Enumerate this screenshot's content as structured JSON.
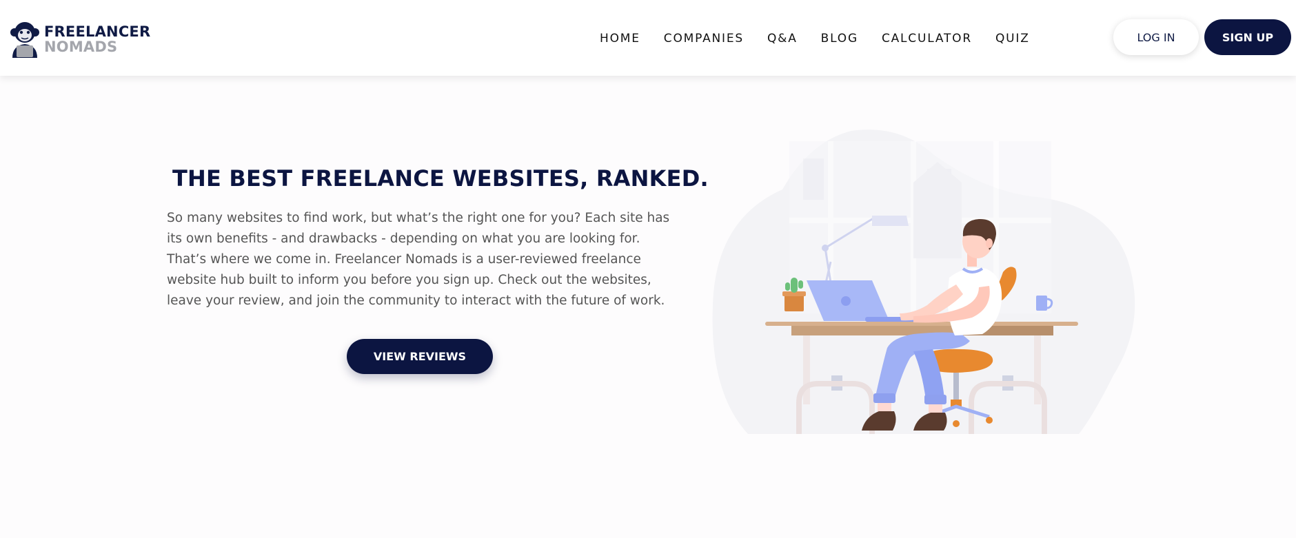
{
  "brand": {
    "name_top": "FREELANCER",
    "name_bottom": "NOMADS"
  },
  "nav": {
    "items": [
      "HOME",
      "COMPANIES",
      "Q&A",
      "BLOG",
      "CALCULATOR",
      "QUIZ"
    ]
  },
  "auth": {
    "login_label": "LOG IN",
    "signup_label": "SIGN UP"
  },
  "hero": {
    "title": "THE BEST FREELANCE WEBSITES, RANKED.",
    "body": "So many websites to find work, but what’s the right one for you? Each site has its own benefits - and drawbacks - depending on what you are looking for. That’s where we come in. Freelancer Nomads is a user-reviewed freelance website hub built to inform you before you sign up. Check out the websites, leave your review, and join the community to interact with the future of work.",
    "cta_label": "VIEW REVIEWS"
  },
  "colors": {
    "navy": "#0c1541",
    "text": "#555555",
    "accent_blue": "#9fb0f5",
    "accent_orange": "#e8892f"
  }
}
